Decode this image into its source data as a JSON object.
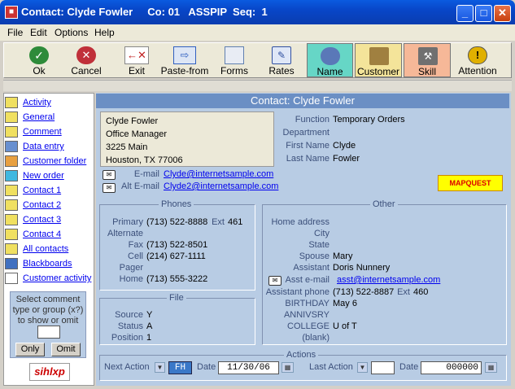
{
  "window": {
    "title": "Contact: Clyde Fowler     Co: 01   ASSPIP  Seq:  1"
  },
  "menu": [
    {
      "label": "File"
    },
    {
      "label": "Edit"
    },
    {
      "label": "Options"
    },
    {
      "label": "Help"
    }
  ],
  "toolbar": [
    {
      "label": "Ok",
      "color": "#2e8b3a"
    },
    {
      "label": "Cancel",
      "color": "#c0303a"
    },
    {
      "label": "Exit",
      "color": "#c02020"
    },
    {
      "label": "Paste-from",
      "color": "#3060c0"
    },
    {
      "label": "Forms",
      "color": "#6080b0"
    },
    {
      "label": "Rates",
      "color": "#3050a0"
    },
    {
      "label": "Name",
      "color": "#5a78b8"
    },
    {
      "label": "Customer",
      "color": "#a08040"
    },
    {
      "label": "Skill",
      "color": "#707070"
    },
    {
      "label": "Attention",
      "color": "#e0b000"
    }
  ],
  "nav": [
    {
      "label": "Activity"
    },
    {
      "label": "General"
    },
    {
      "label": "Comment"
    },
    {
      "label": "Data entry"
    },
    {
      "label": "Customer folder"
    },
    {
      "label": "New order"
    },
    {
      "label": "Contact 1"
    },
    {
      "label": "Contact 2"
    },
    {
      "label": "Contact 3"
    },
    {
      "label": "Contact 4"
    },
    {
      "label": "All contacts"
    },
    {
      "label": "Blackboards"
    },
    {
      "label": "Customer activity"
    }
  ],
  "select_comment": {
    "text": "Select comment type or group (x?) to show or omit",
    "only": "Only",
    "omit": "Omit"
  },
  "logo": "sihlxp",
  "contact": {
    "header": "Contact: Clyde Fowler",
    "address": {
      "line1": "Clyde Fowler",
      "line2": "Office Manager",
      "line3": "3225 Main",
      "line4": "Houston, TX  77006"
    },
    "function_label": "Function",
    "function": "Temporary Orders",
    "department_label": "Department",
    "department": "",
    "first_name_label": "First Name",
    "first_name": "Clyde",
    "last_name_label": "Last Name",
    "last_name": "Fowler",
    "email_label": "E-mail",
    "email": "Clyde@internetsample.com",
    "alt_email_label": "Alt E-mail",
    "alt_email": "Clyde2@internetsample.com",
    "mapquest": "MAPQUEST"
  },
  "phones": {
    "title": "Phones",
    "primary_label": "Primary",
    "primary": "(713) 522-8888",
    "ext_label": "Ext",
    "ext": "461",
    "alternate_label": "Alternate",
    "fax_label": "Fax",
    "fax": "(713) 522-8501",
    "cell_label": "Cell",
    "cell": "(214) 627-1111",
    "pager_label": "Pager",
    "home_label": "Home",
    "home": "(713) 555-3222"
  },
  "file": {
    "title": "File",
    "source_label": "Source",
    "source": "Y",
    "status_label": "Status",
    "status": "A",
    "position_label": "Position",
    "position": "1"
  },
  "other": {
    "title": "Other",
    "home_address_label": "Home address",
    "city_label": "City",
    "state_label": "State",
    "spouse_label": "Spouse",
    "spouse": "Mary",
    "assistant_label": "Assistant",
    "assistant": "Doris Nunnery",
    "asst_email_label": "Asst e-mail",
    "asst_email": "asst@internetsample.com",
    "assistant_phone_label": "Assistant phone",
    "assistant_phone": "(713) 522-8887",
    "asst_ext_label": "Ext",
    "asst_ext": "460",
    "birthday_label": "BIRTHDAY",
    "birthday": "May 6",
    "anniversary_label": "ANNIVSRY",
    "college_label": "COLLEGE",
    "college": "U of T",
    "blank_label": "(blank)"
  },
  "actions": {
    "title": "Actions",
    "next_action_label": "Next Action",
    "next_action": "FH",
    "date_label": "Date",
    "next_date": "11/30/06",
    "last_action_label": "Last Action",
    "last_action": "",
    "last_date_label": "Date",
    "last_date": "000000"
  }
}
